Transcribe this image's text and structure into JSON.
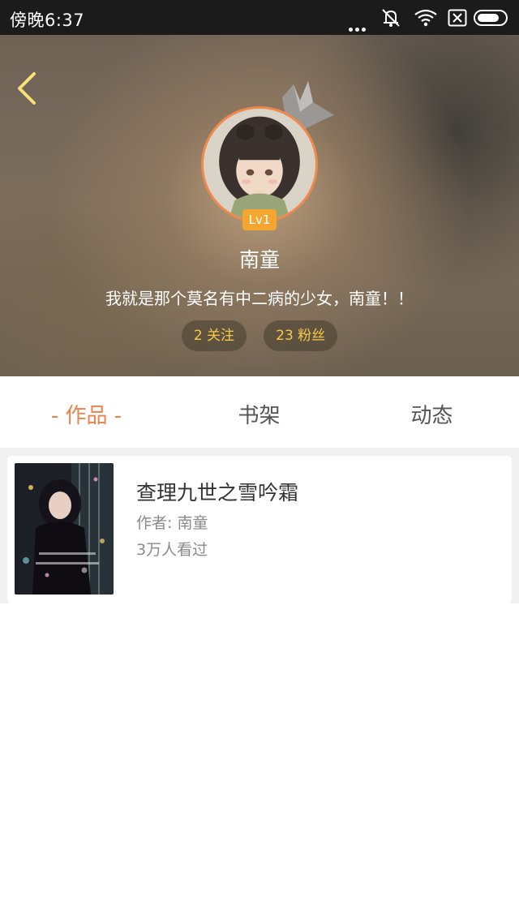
{
  "status_bar": {
    "time": "傍晚6:37"
  },
  "profile": {
    "level": "Lv1",
    "name": "南童",
    "bio": "我就是那个莫名有中二病的少女，南童！！",
    "following": "2 关注",
    "followers": "23 粉丝"
  },
  "tabs": [
    {
      "label": "- 作品 -",
      "active": true
    },
    {
      "label": "书架",
      "active": false
    },
    {
      "label": "动态",
      "active": false
    }
  ],
  "books": [
    {
      "title": "查理九世之雪吟霜",
      "author": "作者: 南童",
      "views": "3万人看过"
    }
  ],
  "colors": {
    "accent": "#f0804a",
    "level_badge": "#f4a630",
    "stat_text": "#f7c948",
    "back_arrow": "#f7e07a"
  },
  "icons": {
    "back": "chevron-left-icon",
    "crown": "crown-icon",
    "mute": "bell-muted-icon",
    "wifi": "wifi-icon",
    "sim": "no-sim-icon",
    "battery": "battery-icon"
  }
}
